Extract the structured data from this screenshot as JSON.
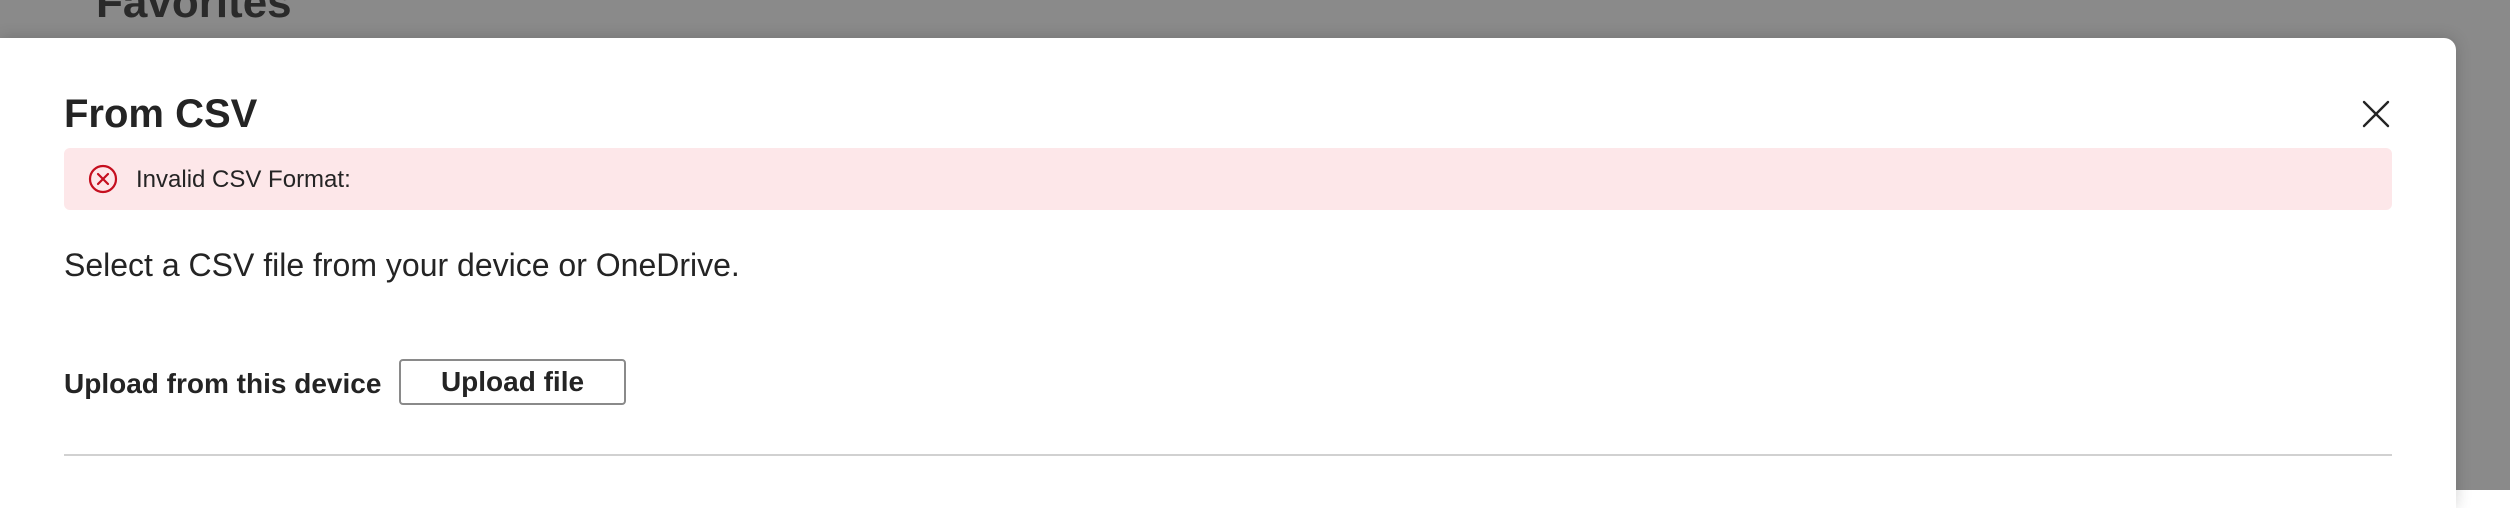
{
  "background": {
    "heading": "Favorites"
  },
  "dialog": {
    "title": "From CSV",
    "close_icon": "close-icon",
    "error": {
      "icon": "error-circle-icon",
      "message": "Invalid CSV Format:",
      "color": "#c50f1f",
      "background": "#fde7e9"
    },
    "description": "Select a CSV file from your device or OneDrive.",
    "upload": {
      "label": "Upload from this device",
      "button_label": "Upload file"
    }
  }
}
